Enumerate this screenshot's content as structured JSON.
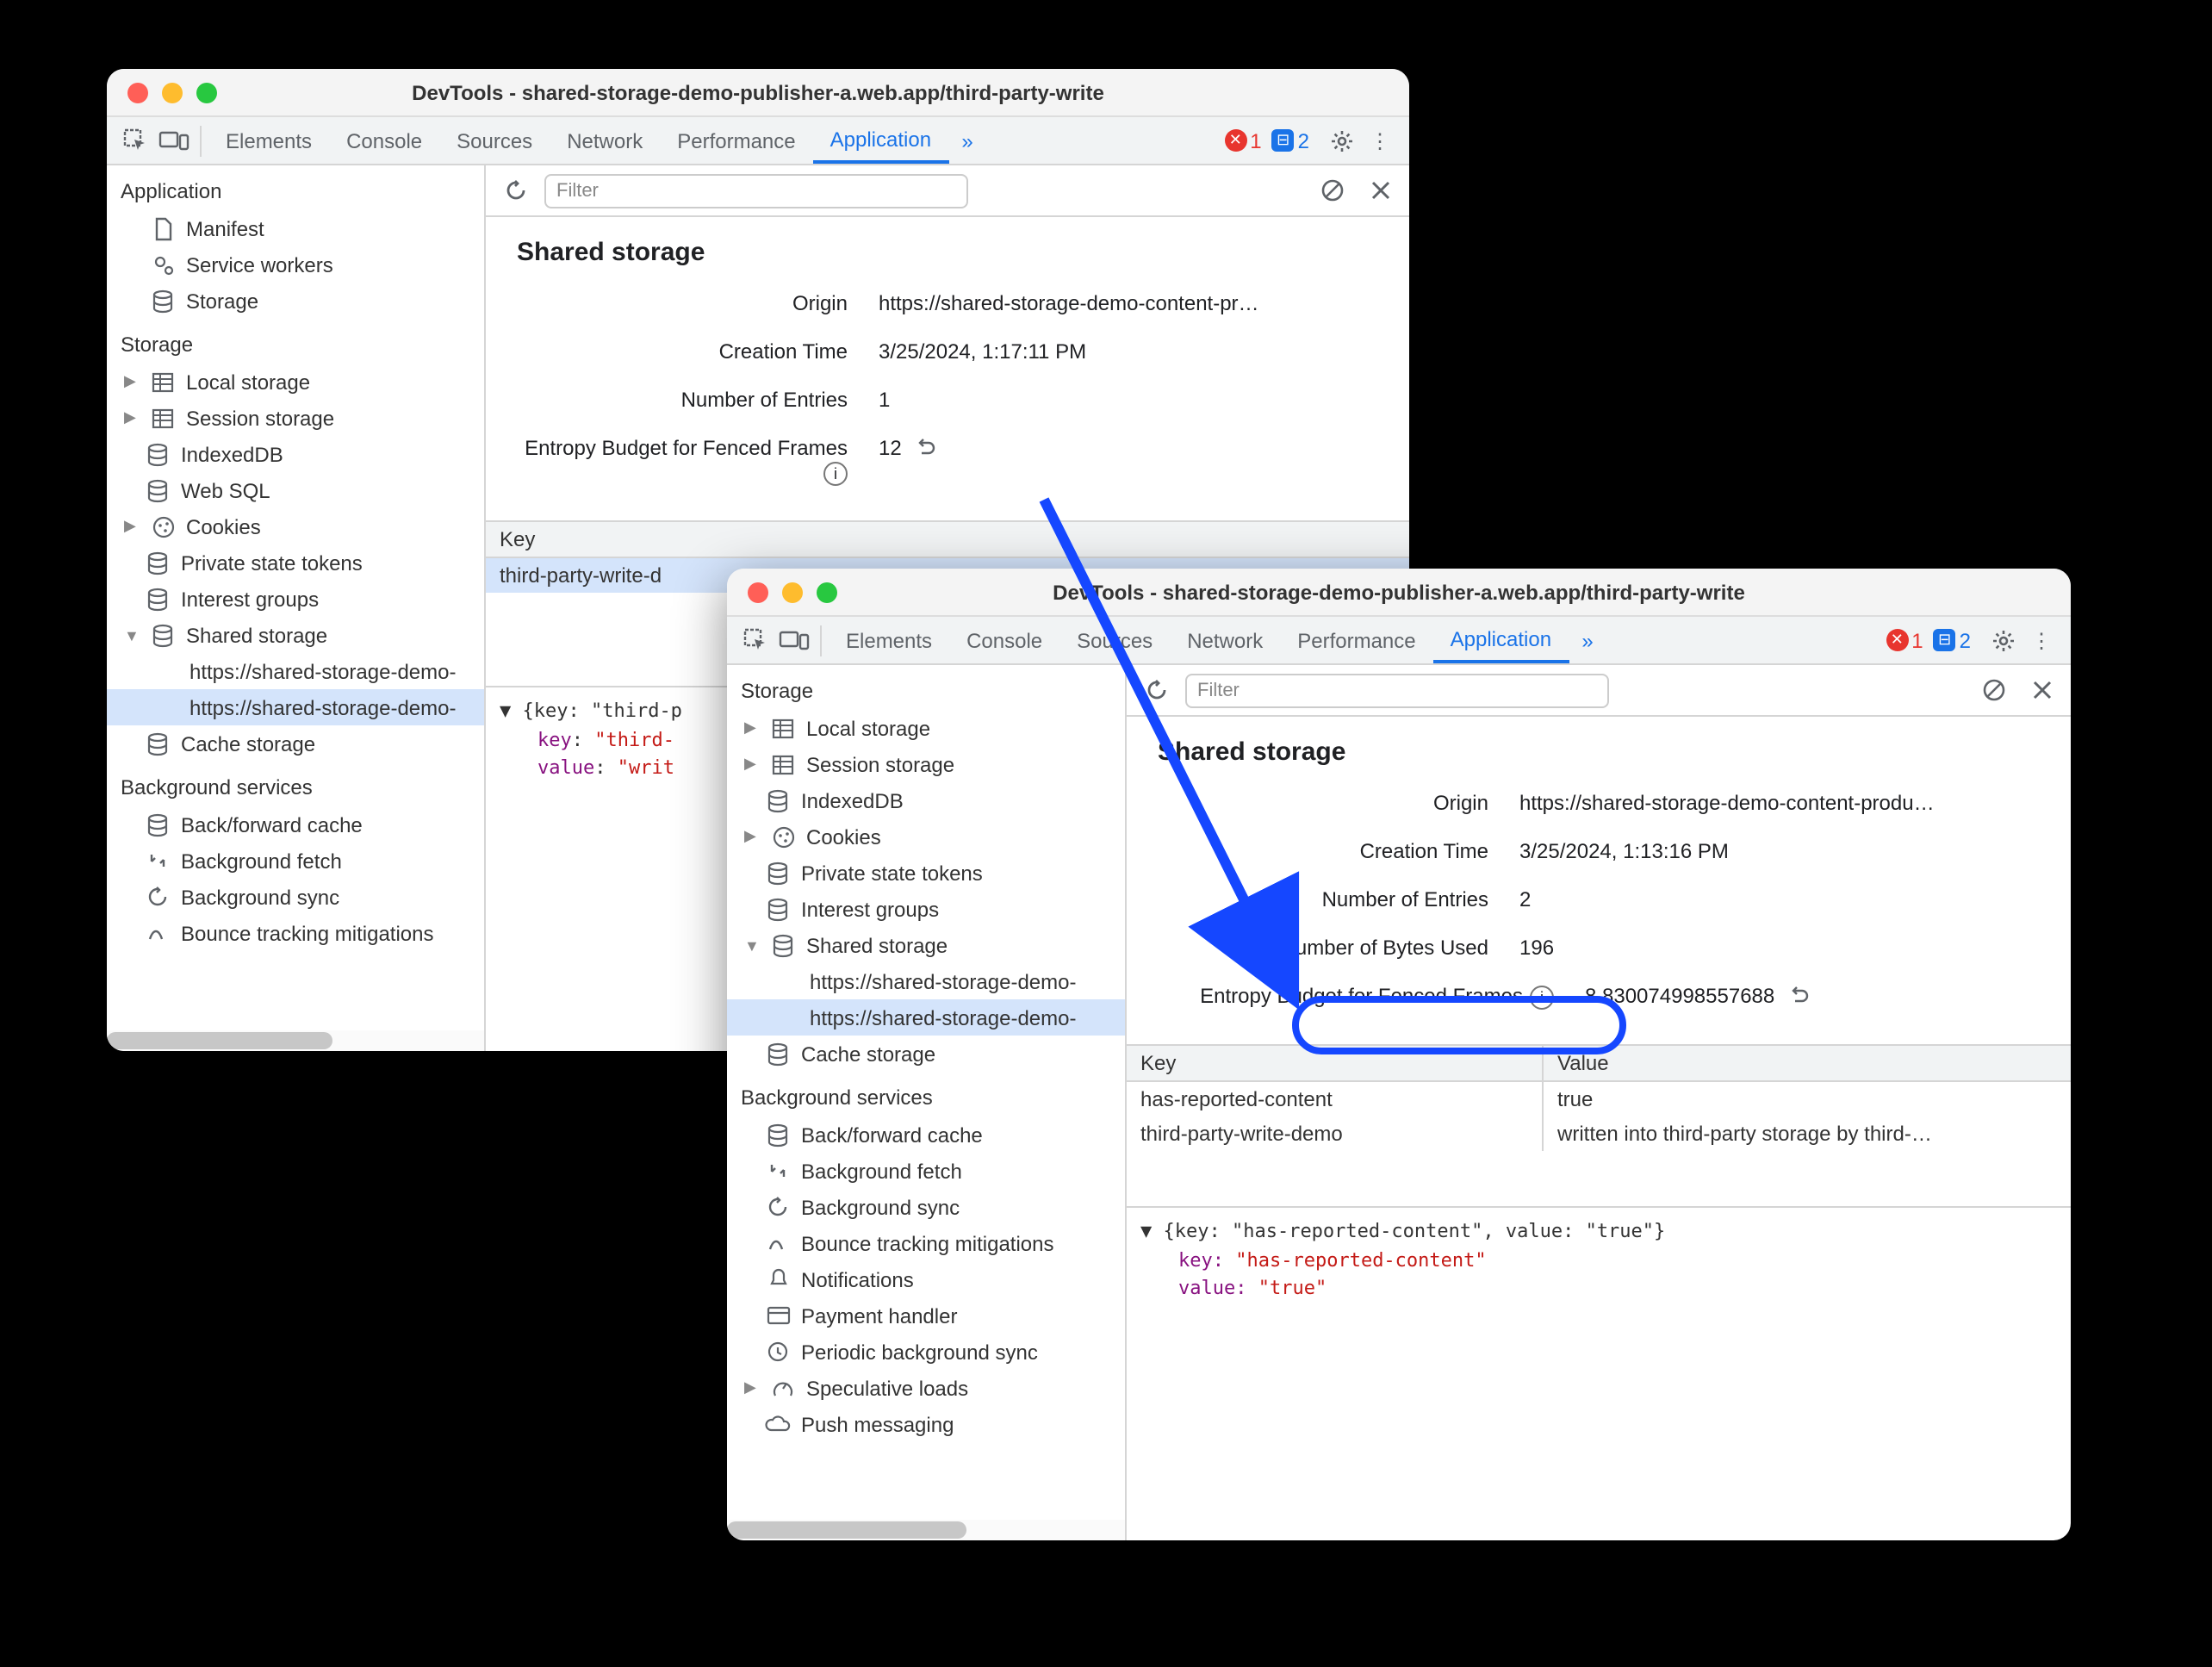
{
  "title": "DevTools - shared-storage-demo-publisher-a.web.app/third-party-write",
  "tabs": [
    "Elements",
    "Console",
    "Sources",
    "Network",
    "Performance",
    "Application"
  ],
  "activeTab": "Application",
  "err_count": "1",
  "msg_count": "2",
  "filter_placeholder": "Filter",
  "sidebarA": {
    "app_header": "Application",
    "manifest": "Manifest",
    "sw": "Service workers",
    "storage": "Storage",
    "st_header": "Storage",
    "local": "Local storage",
    "session": "Session storage",
    "idb": "IndexedDB",
    "websql": "Web SQL",
    "cookies": "Cookies",
    "pst": "Private state tokens",
    "ig": "Interest groups",
    "ss": "Shared storage",
    "ss1": "https://shared-storage-demo-",
    "ss2": "https://shared-storage-demo-",
    "cache": "Cache storage",
    "bg_header": "Background services",
    "bfc": "Back/forward cache",
    "bgf": "Background fetch",
    "bgs": "Background sync",
    "btm": "Bounce tracking mitigations"
  },
  "detailA": {
    "heading": "Shared storage",
    "origin_k": "Origin",
    "origin_v": "https://shared-storage-demo-content-pr…",
    "ct_k": "Creation Time",
    "ct_v": "3/25/2024, 1:17:11 PM",
    "ne_k": "Number of Entries",
    "ne_v": "1",
    "eb_k": "Entropy Budget for Fenced Frames",
    "eb_v": "12",
    "key_col": "Key",
    "key_row": "third-party-write-d",
    "obj_line1": "{key: \"third-p",
    "obj_key": "\"third-",
    "obj_val": "\"writ"
  },
  "sidebarB": {
    "st_header": "Storage",
    "local": "Local storage",
    "session": "Session storage",
    "idb": "IndexedDB",
    "cookies": "Cookies",
    "pst": "Private state tokens",
    "ig": "Interest groups",
    "ss": "Shared storage",
    "ss1": "https://shared-storage-demo-",
    "ss2": "https://shared-storage-demo-",
    "cache": "Cache storage",
    "bg_header": "Background services",
    "bfc": "Back/forward cache",
    "bgf": "Background fetch",
    "bgs": "Background sync",
    "btm": "Bounce tracking mitigations",
    "notif": "Notifications",
    "pay": "Payment handler",
    "pbs": "Periodic background sync",
    "spec": "Speculative loads",
    "push": "Push messaging"
  },
  "detailB": {
    "heading": "Shared storage",
    "origin_k": "Origin",
    "origin_v": "https://shared-storage-demo-content-produ…",
    "ct_k": "Creation Time",
    "ct_v": "3/25/2024, 1:13:16 PM",
    "ne_k": "Number of Entries",
    "ne_v": "2",
    "nb_k": "Number of Bytes Used",
    "nb_v": "196",
    "eb_k": "Entropy Budget for Fenced Frames",
    "eb_v": "8.830074998557688",
    "key_col": "Key",
    "val_col": "Value",
    "r1k": "has-reported-content",
    "r1v": "true",
    "r2k": "third-party-write-demo",
    "r2v": "written into third-party storage by third-…",
    "obj_line1": "{key: \"has-reported-content\", value: \"true\"}",
    "obj_keylbl": "key: ",
    "obj_key": "\"has-reported-content\"",
    "obj_vallbl": "value: ",
    "obj_val": "\"true\""
  }
}
